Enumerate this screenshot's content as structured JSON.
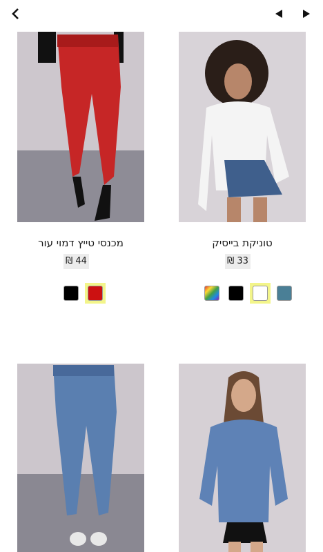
{
  "nav": {
    "back_icon": "chevron-left-icon",
    "prev_icon": "caret-left-icon",
    "next_icon": "caret-right-icon"
  },
  "products": [
    {
      "name": "מכנסי טייץ דמוי עור",
      "price": "44 ₪",
      "swatches": [
        {
          "color": "#cc1111",
          "selected": true
        },
        {
          "color": "#000000",
          "selected": false
        }
      ]
    },
    {
      "name": "טוניקת בייסיק",
      "price": "33 ₪",
      "swatches": [
        {
          "color": "#4a7f96",
          "selected": false
        },
        {
          "color": "#ffffff",
          "selected": true
        },
        {
          "color": "#000000",
          "selected": false
        },
        {
          "color": "rainbow",
          "selected": false
        }
      ]
    },
    {
      "name": "",
      "price": "",
      "swatches": []
    },
    {
      "name": "",
      "price": "",
      "swatches": []
    }
  ],
  "colors": {
    "selected_highlight": "#f3f58a",
    "price_bg": "#ececec",
    "photo_bg": "#d8d3d8"
  }
}
